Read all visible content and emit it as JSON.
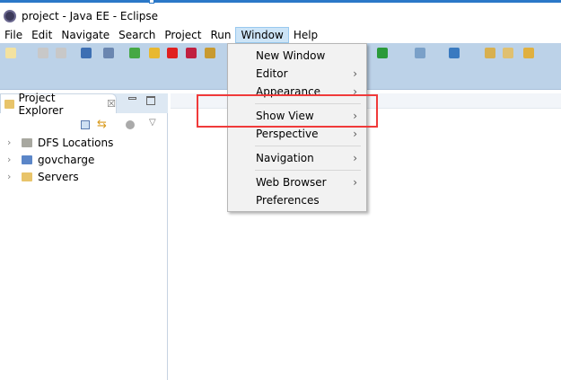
{
  "window": {
    "title": "project - Java EE - Eclipse"
  },
  "menubar": [
    "File",
    "Edit",
    "Navigate",
    "Search",
    "Project",
    "Run",
    "Window",
    "Help"
  ],
  "window_menu": [
    {
      "label": "New Window",
      "submenu": false
    },
    {
      "label": "Editor",
      "submenu": true
    },
    {
      "label": "Appearance",
      "submenu": true
    },
    {
      "sep": true
    },
    {
      "label": "Show View",
      "submenu": true
    },
    {
      "label": "Perspective",
      "submenu": true
    },
    {
      "sep": true
    },
    {
      "label": "Navigation",
      "submenu": true
    },
    {
      "sep": true
    },
    {
      "label": "Web Browser",
      "submenu": true
    },
    {
      "label": "Preferences",
      "submenu": false
    }
  ],
  "project_explorer": {
    "tab": "Project Explorer",
    "close": "☒",
    "items": [
      "DFS Locations",
      "govcharge",
      "Servers"
    ]
  },
  "colors": {
    "highlight": "#f03a3a",
    "toolbar": "#bcd2e8"
  }
}
